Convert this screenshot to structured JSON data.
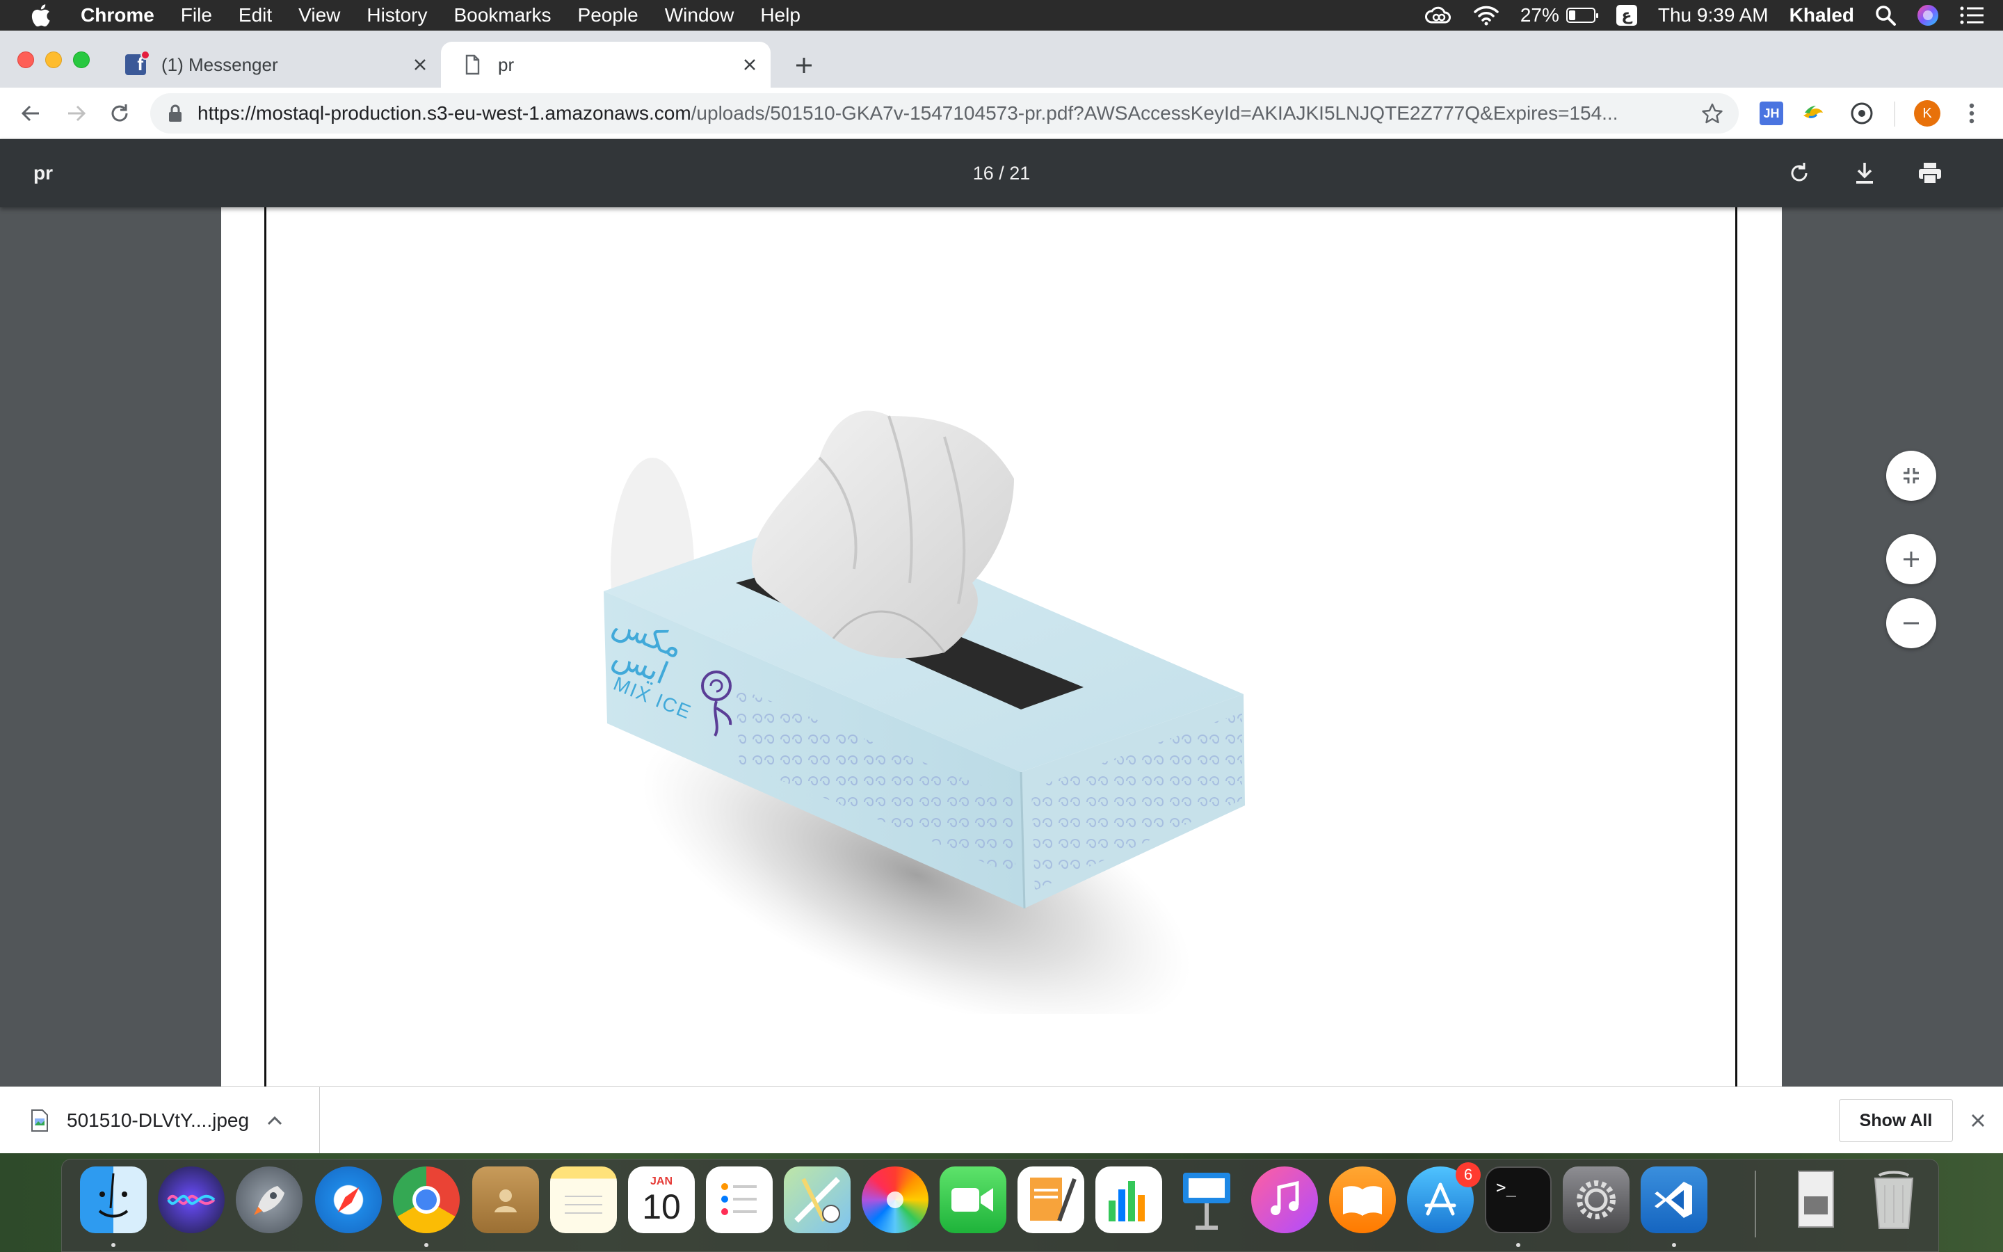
{
  "menubar": {
    "app_name": "Chrome",
    "menus": [
      "File",
      "Edit",
      "View",
      "History",
      "Bookmarks",
      "People",
      "Window",
      "Help"
    ],
    "battery_percent": "27%",
    "battery_level": 0.27,
    "input_source": "ع",
    "clock": "Thu 9:39 AM",
    "user": "Khaled"
  },
  "tabs": {
    "inactive_title": "(1) Messenger",
    "active_title": "pr"
  },
  "toolbar": {
    "url_host": "https://mostaql-production.s3-eu-west-1.amazonaws.com",
    "url_rest": "/uploads/501510-GKA7v-1547104573-pr.pdf?AWSAccessKeyId=AKIAJKI5LNJQTE2Z777Q&Expires=154...",
    "extension_jh_label": "JH",
    "profile_initial": "K"
  },
  "pdf": {
    "title": "pr",
    "page_current": "16",
    "page_total": "21",
    "page_display": "16  / 21",
    "product": {
      "arabic_text_line1": "مكس",
      "arabic_text_line2": "ايس",
      "brand": "MIX ICE"
    }
  },
  "download_bar": {
    "filename": "501510-DLVtY....jpeg",
    "show_all_label": "Show All"
  },
  "dock": {
    "app_store_badge": "6",
    "calendar_month": "JAN",
    "calendar_day": "10",
    "terminal_prompt": ">_"
  },
  "colors": {
    "menubar_bg": "#2b2b2b",
    "tabstrip_bg": "#dee1e6",
    "pdf_toolbar_bg": "#323639",
    "pdf_background": "#525659",
    "profile_avatar": "#e8710a",
    "box_blue": "#cfe6ee"
  }
}
